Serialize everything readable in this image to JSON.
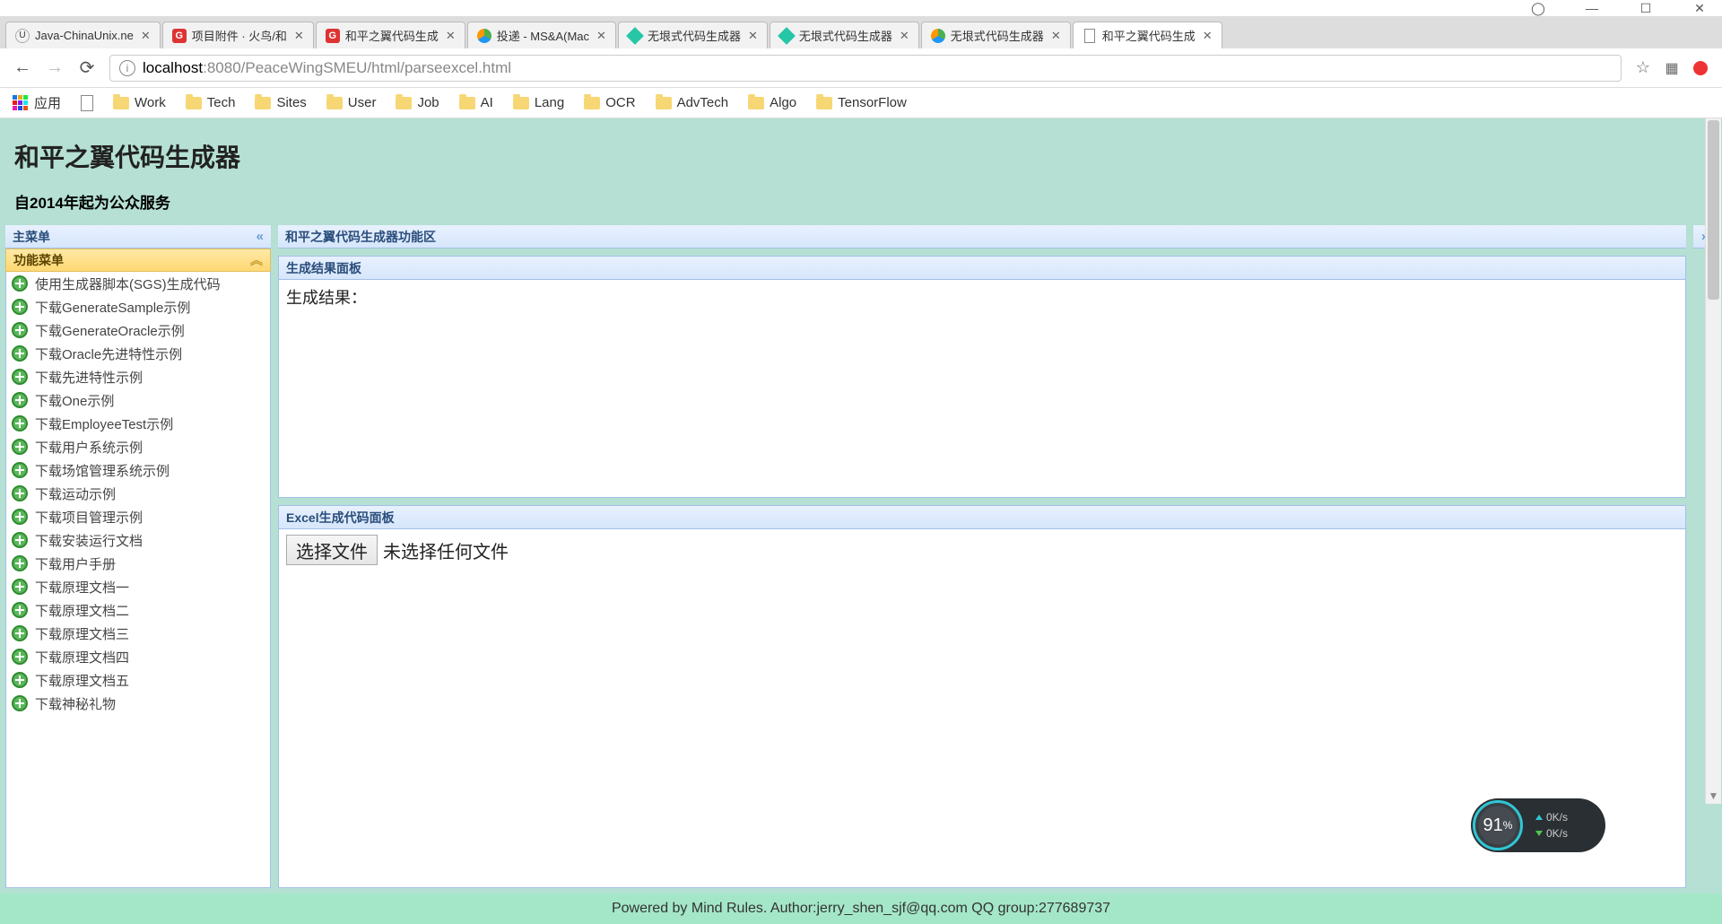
{
  "window": {
    "user_icon": "◯",
    "minimize": "—",
    "maximize": "☐",
    "close": "✕"
  },
  "tabs": [
    {
      "title": "Java-ChinaUnix.ne",
      "icon": "u"
    },
    {
      "title": "项目附件 · 火鸟/和",
      "icon": "g"
    },
    {
      "title": "和平之翼代码生成",
      "icon": "g"
    },
    {
      "title": "投递 - MS&A(Mac",
      "icon": "c"
    },
    {
      "title": "无垠式代码生成器",
      "icon": "diamond"
    },
    {
      "title": "无垠式代码生成器",
      "icon": "diamond"
    },
    {
      "title": "无垠式代码生成器",
      "icon": "c"
    },
    {
      "title": "和平之翼代码生成",
      "icon": "doc",
      "active": true
    }
  ],
  "addressbar": {
    "scheme": "localhost",
    "port_path": ":8080/PeaceWingSMEU/html/parseexcel.html"
  },
  "bookmarks": {
    "apps_label": "应用",
    "items": [
      "Work",
      "Tech",
      "Sites",
      "User",
      "Job",
      "AI",
      "Lang",
      "OCR",
      "AdvTech",
      "Algo",
      "TensorFlow"
    ]
  },
  "page": {
    "title": "和平之翼代码生成器",
    "subtitle": "自2014年起为公众服务",
    "left_header": "主菜单",
    "accordion_header": "功能菜单",
    "menu_items": [
      "使用生成器脚本(SGS)生成代码",
      "下载GenerateSample示例",
      "下载GenerateOracle示例",
      "下载Oracle先进特性示例",
      "下载先进特性示例",
      "下载One示例",
      "下载EmployeeTest示例",
      "下载用户系统示例",
      "下载场馆管理系统示例",
      "下载运动示例",
      "下载项目管理示例",
      "下载安装运行文档",
      "下载用户手册",
      "下载原理文档一",
      "下载原理文档二",
      "下载原理文档三",
      "下载原理文档四",
      "下载原理文档五",
      "下载神秘礼物"
    ],
    "center_header": "和平之翼代码生成器功能区",
    "result_panel_title": "生成结果面板",
    "result_label": "生成结果：",
    "excel_panel_title": "Excel生成代码面板",
    "file_button": "选择文件",
    "file_status": "未选择任何文件",
    "footer": "Powered by Mind Rules. Author:jerry_shen_sjf@qq.com QQ group:277689737"
  },
  "widget": {
    "percent": "91",
    "percent_suffix": "%",
    "up_rate": "0K/s",
    "down_rate": "0K/s"
  }
}
